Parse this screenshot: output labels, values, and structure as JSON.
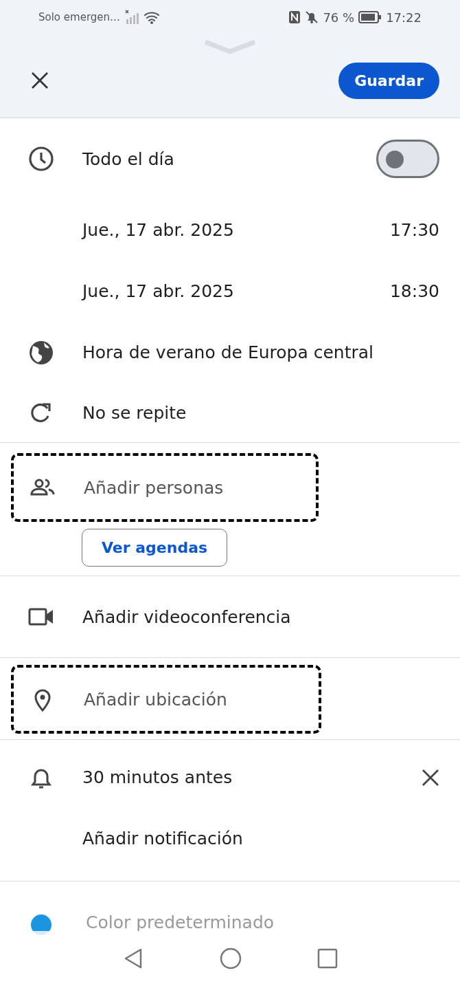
{
  "status_bar": {
    "carrier": "Solo emergen…",
    "battery": "76 %",
    "time": "17:22"
  },
  "toolbar": {
    "save_button": "Guardar"
  },
  "all_day": {
    "label": "Todo el día",
    "on": false
  },
  "start": {
    "date": "Jue., 17 abr. 2025",
    "time": "17:30"
  },
  "end": {
    "date": "Jue., 17 abr. 2025",
    "time": "18:30"
  },
  "timezone": "Hora de verano de Europa central",
  "repeat": "No se repite",
  "people": {
    "placeholder": "Añadir personas",
    "outlined": true,
    "calendars_button": "Ver agendas"
  },
  "video": {
    "label": "Añadir videoconferencia"
  },
  "location": {
    "placeholder": "Añadir ubicación",
    "outlined": true
  },
  "notifications": [
    {
      "text": "30 minutos antes"
    }
  ],
  "add_notification": "Añadir notificación",
  "event_color": {
    "label": "Color predeterminado",
    "color": "#1a96e0"
  }
}
